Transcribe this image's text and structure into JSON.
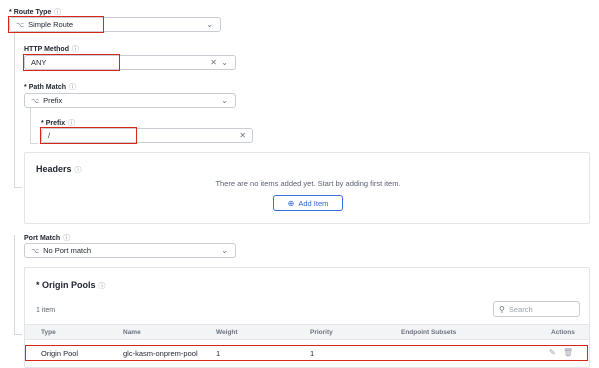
{
  "route_type": {
    "label": "Route Type",
    "required_mark": "*",
    "value": "Simple Route",
    "icon": "route-icon"
  },
  "http_method": {
    "label": "HTTP Method",
    "value": "ANY"
  },
  "path_match": {
    "label": "Path Match",
    "required_mark": "*",
    "value": "Prefix"
  },
  "prefix": {
    "label": "Prefix",
    "required_mark": "*",
    "value": "/"
  },
  "headers": {
    "title": "Headers",
    "empty_text": "There are no items added yet. Start by adding first item.",
    "add_button": "Add Item"
  },
  "port_match": {
    "label": "Port Match",
    "value": "No Port match"
  },
  "origin_pools": {
    "title": "Origin Pools",
    "required_mark": "*",
    "count_text": "1 item",
    "search_placeholder": "Search",
    "columns": [
      "Type",
      "Name",
      "Weight",
      "Priority",
      "Endpoint Subsets",
      "Actions"
    ],
    "rows": [
      {
        "type": "Origin Pool",
        "name": "glc-kasm-onprem-pool",
        "weight": "1",
        "priority": "1",
        "endpoint_subsets": ""
      }
    ]
  },
  "colors": {
    "highlight": "#d8261c",
    "accent": "#2f63cf",
    "border": "#c9cdd4"
  }
}
